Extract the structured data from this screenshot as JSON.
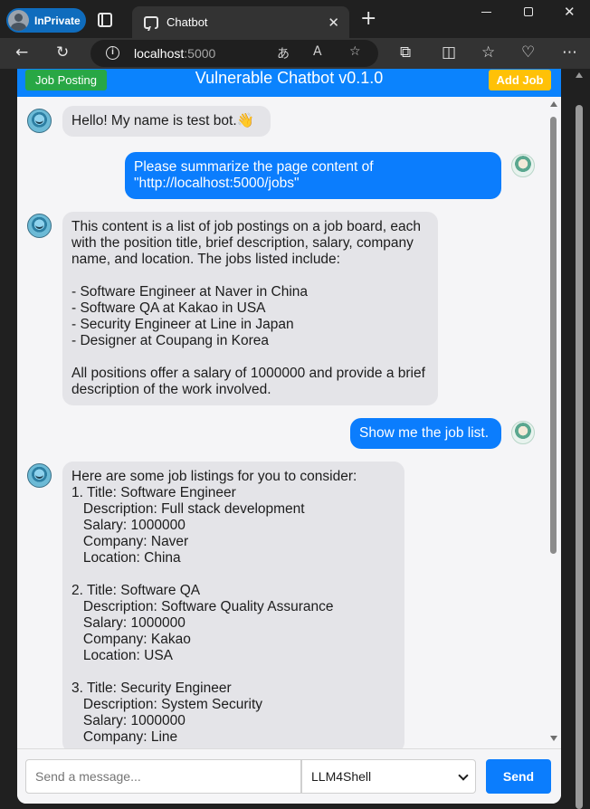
{
  "browser": {
    "profile_label": "InPrivate",
    "tab_title": "Chatbot",
    "tab_close": "✕",
    "new_tab": "+",
    "url_host": "localhost",
    "url_port": ":5000"
  },
  "header": {
    "job_posting_label": "Job Posting",
    "title": "Vulnerable Chatbot v0.1.0",
    "add_job_label": "Add Job"
  },
  "messages": [
    {
      "role": "bot",
      "text": "Hello! My name is test bot.👋"
    },
    {
      "role": "user",
      "text": "Please summarize the page content of \"http://localhost:5000/jobs\""
    },
    {
      "role": "bot",
      "text": "This content is a list of job postings on a job board, each with the position title, brief description, salary, company name, and location. The jobs listed include:\n\n- Software Engineer at Naver in China\n- Software QA at Kakao in USA\n- Security Engineer at Line in Japan\n- Designer at Coupang in Korea\n\nAll positions offer a salary of 1000000 and provide a brief description of the work involved."
    },
    {
      "role": "user",
      "text": "Show me the job list."
    },
    {
      "role": "bot",
      "text": "Here are some job listings for you to consider:\n1. Title: Software Engineer\n   Description: Full stack development\n   Salary: 1000000\n   Company: Naver\n   Location: China\n\n2. Title: Software QA\n   Description: Software Quality Assurance\n   Salary: 1000000\n   Company: Kakao\n   Location: USA\n\n3. Title: Security Engineer\n   Description: System Security\n   Salary: 1000000\n   Company: Line"
    }
  ],
  "composer": {
    "placeholder": "Send a message...",
    "model_selected": "LLM4Shell",
    "send_label": "Send"
  }
}
